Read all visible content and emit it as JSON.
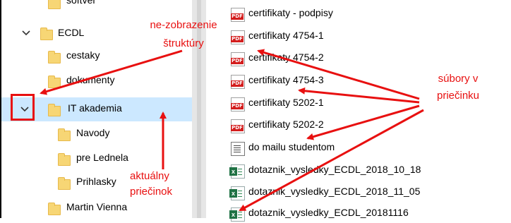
{
  "tree": {
    "items": [
      {
        "label": "softver",
        "indent": 1,
        "chevron": ""
      },
      {
        "label": "ECDL",
        "indent": 0,
        "chevron": "⌄"
      },
      {
        "label": "cestaky",
        "indent": 1,
        "chevron": ""
      },
      {
        "label": "dokumenty",
        "indent": 1,
        "chevron": ""
      },
      {
        "label": "IT akademia",
        "indent": 0,
        "chevron": "⌄"
      },
      {
        "label": "Navody",
        "indent": 2,
        "chevron": ""
      },
      {
        "label": "pre Lednela",
        "indent": 2,
        "chevron": ""
      },
      {
        "label": "Prihlasky",
        "indent": 2,
        "chevron": ""
      },
      {
        "label": "Martin Vienna",
        "indent": 1,
        "chevron": ""
      }
    ]
  },
  "files": [
    {
      "name": "certifikaty - podpisy",
      "type": "pdf"
    },
    {
      "name": "certifikaty 4754-1",
      "type": "pdf"
    },
    {
      "name": "certifikaty 4754-2",
      "type": "pdf"
    },
    {
      "name": "certifikaty 4754-3",
      "type": "pdf"
    },
    {
      "name": "certifikaty 5202-1",
      "type": "pdf"
    },
    {
      "name": "certifikaty 5202-2",
      "type": "pdf"
    },
    {
      "name": "do mailu studentom",
      "type": "doc"
    },
    {
      "name": "dotaznik_vysledky_ECDL_2018_10_18",
      "type": "xlsx"
    },
    {
      "name": "dotaznik_vysledky_ECDL_2018_11_05",
      "type": "xlsx"
    },
    {
      "name": "dotaznik_vysledky_ECDL_20181116",
      "type": "xlsx"
    }
  ],
  "annotations": {
    "structure_line1": "ne-zobrazenie",
    "structure_line2": "štruktúry",
    "current_line1": "aktuálny",
    "current_line2": "priečinok",
    "files_line1": "súbory v",
    "files_line2": "priečinku"
  },
  "pdf_tag": "PDF",
  "xls_tag": "x",
  "colors": {
    "annotation": "#e81010",
    "selection": "#cce8ff",
    "folder": "#f7d675"
  }
}
